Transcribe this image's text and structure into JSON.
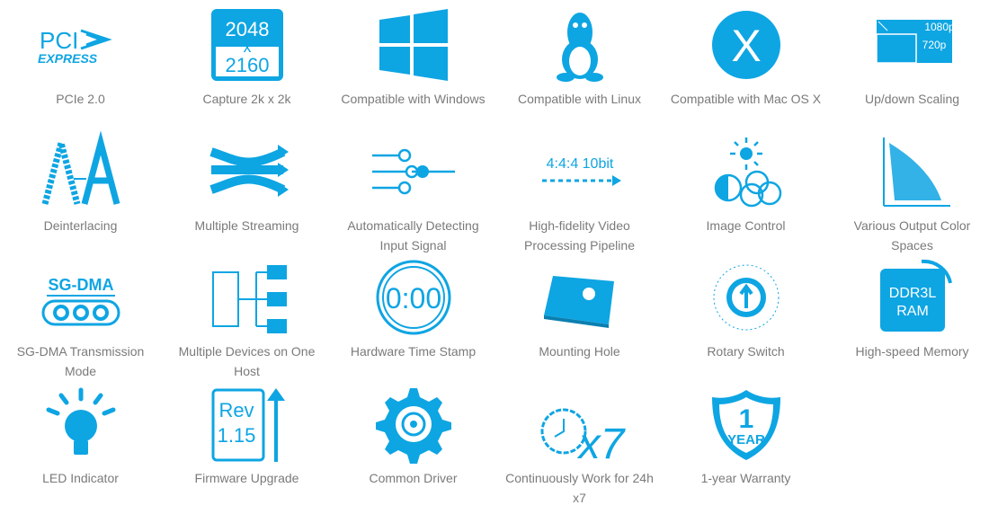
{
  "accent": "#0ea5e3",
  "features": [
    {
      "icon": "pcie-logo-icon",
      "label": "PCIe 2.0",
      "icon_text": [
        "PCI",
        "EXPRESS"
      ]
    },
    {
      "icon": "resolution-icon",
      "label": "Capture 2k x 2k",
      "icon_text": [
        "2048",
        "x",
        "2160"
      ]
    },
    {
      "icon": "windows-icon",
      "label": "Compatible with Windows"
    },
    {
      "icon": "linux-icon",
      "label": "Compatible with Linux"
    },
    {
      "icon": "mac-os-x-icon",
      "label": "Compatible with Mac OS X",
      "icon_text": [
        "X"
      ]
    },
    {
      "icon": "scaling-icon",
      "label": "Up/down Scaling",
      "icon_text": [
        "1080p",
        "720p"
      ]
    },
    {
      "icon": "deinterlacing-icon",
      "label": "Deinterlacing"
    },
    {
      "icon": "multiple-streaming-icon",
      "label": "Multiple Streaming"
    },
    {
      "icon": "input-detect-icon",
      "label": "Automatically Detecting Input Signal"
    },
    {
      "icon": "pipeline-icon",
      "label": "High-fidelity Video Processing Pipeline",
      "icon_text": [
        "4:4:4 10bit"
      ]
    },
    {
      "icon": "image-control-icon",
      "label": "Image Control"
    },
    {
      "icon": "color-space-icon",
      "label": "Various Output Color Spaces"
    },
    {
      "icon": "sg-dma-icon",
      "label": "SG-DMA Transmission Mode",
      "icon_text": [
        "SG-DMA"
      ]
    },
    {
      "icon": "multi-device-icon",
      "label": "Multiple Devices on One Host"
    },
    {
      "icon": "timestamp-icon",
      "label": "Hardware Time Stamp",
      "icon_text": [
        "0:00"
      ]
    },
    {
      "icon": "mounting-hole-icon",
      "label": "Mounting Hole"
    },
    {
      "icon": "rotary-switch-icon",
      "label": "Rotary Switch"
    },
    {
      "icon": "memory-icon",
      "label": "High-speed Memory",
      "icon_text": [
        "DDR3L",
        "RAM"
      ]
    },
    {
      "icon": "led-bulb-icon",
      "label": "LED Indicator"
    },
    {
      "icon": "firmware-upgrade-icon",
      "label": "Firmware Upgrade",
      "icon_text": [
        "Rev",
        "1.15"
      ]
    },
    {
      "icon": "gear-icon",
      "label": "Common Driver"
    },
    {
      "icon": "clock-icon",
      "label": "Continuously Work for 24h x7",
      "icon_text": [
        "x7"
      ]
    },
    {
      "icon": "warranty-shield-icon",
      "label": "1-year Warranty",
      "icon_text": [
        "1",
        "YEAR"
      ]
    }
  ]
}
